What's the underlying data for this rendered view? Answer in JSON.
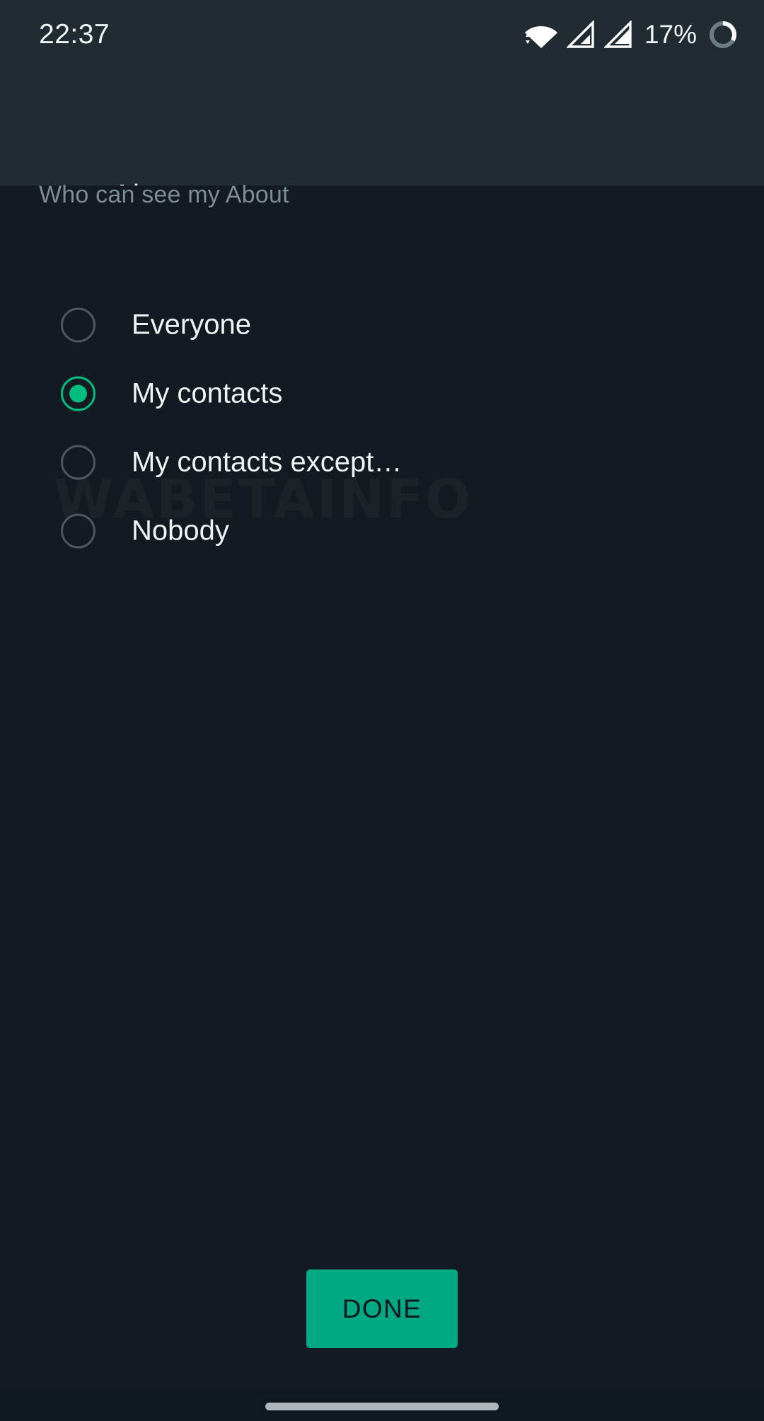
{
  "status_bar": {
    "time": "22:37",
    "battery_percent": "17%",
    "icons": [
      "wifi-icon",
      "signal-icon",
      "signal-icon",
      "battery-circle-icon"
    ]
  },
  "app_bar": {
    "back_icon": "arrow-left-icon",
    "title": "About"
  },
  "content": {
    "section_header": "Who can see my About",
    "watermark": "WABETAINFO",
    "options": [
      {
        "label": "Everyone",
        "selected": false
      },
      {
        "label": "My contacts",
        "selected": true
      },
      {
        "label": "My contacts except…",
        "selected": false
      },
      {
        "label": "Nobody",
        "selected": false
      }
    ]
  },
  "footer": {
    "done_label": "DONE"
  },
  "colors": {
    "accent_green": "#00bd7e",
    "button_green": "#00a884",
    "app_bar_bg": "#212c32",
    "content_bg": "#131a21",
    "nav_bar_bg": "#101820",
    "primary_text": "#f0f3f4",
    "secondary_text": "#7e8c93",
    "radio_unselected": "#4c575e"
  }
}
